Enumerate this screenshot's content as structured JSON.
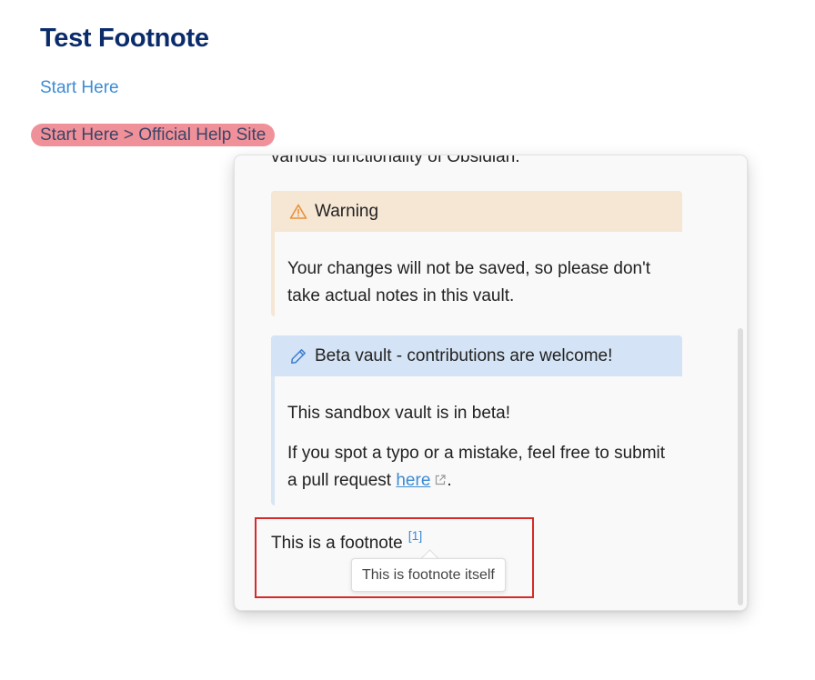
{
  "page": {
    "title": "Test Footnote",
    "link": "Start Here",
    "breadcrumb": "Start Here > Official Help Site"
  },
  "popover": {
    "cut_text": "various functionality of Obsidian.",
    "warning": {
      "title": "Warning",
      "icon": "warning-triangle-icon",
      "accent": "#e8913a",
      "background": "#f6e6d4",
      "body": "Your changes will not be saved, so please don't take actual notes in this vault."
    },
    "beta": {
      "title": "Beta vault - contributions are welcome!",
      "icon": "pencil-icon",
      "accent": "#3d7fd0",
      "background": "#d4e3f5",
      "body1": "This sandbox vault is in beta!",
      "body2_prefix": "If you spot a typo or a mistake, feel free to submit a pull request ",
      "link": "here",
      "body2_suffix": "."
    },
    "footnote": {
      "text": "This is a footnote",
      "ref": "[1]",
      "tooltip": "This is footnote itself"
    }
  },
  "colors": {
    "title": "#0b2c6b",
    "link": "#3d8bd4",
    "highlight": "#f0919a",
    "annotation_box": "#d62a2a"
  }
}
